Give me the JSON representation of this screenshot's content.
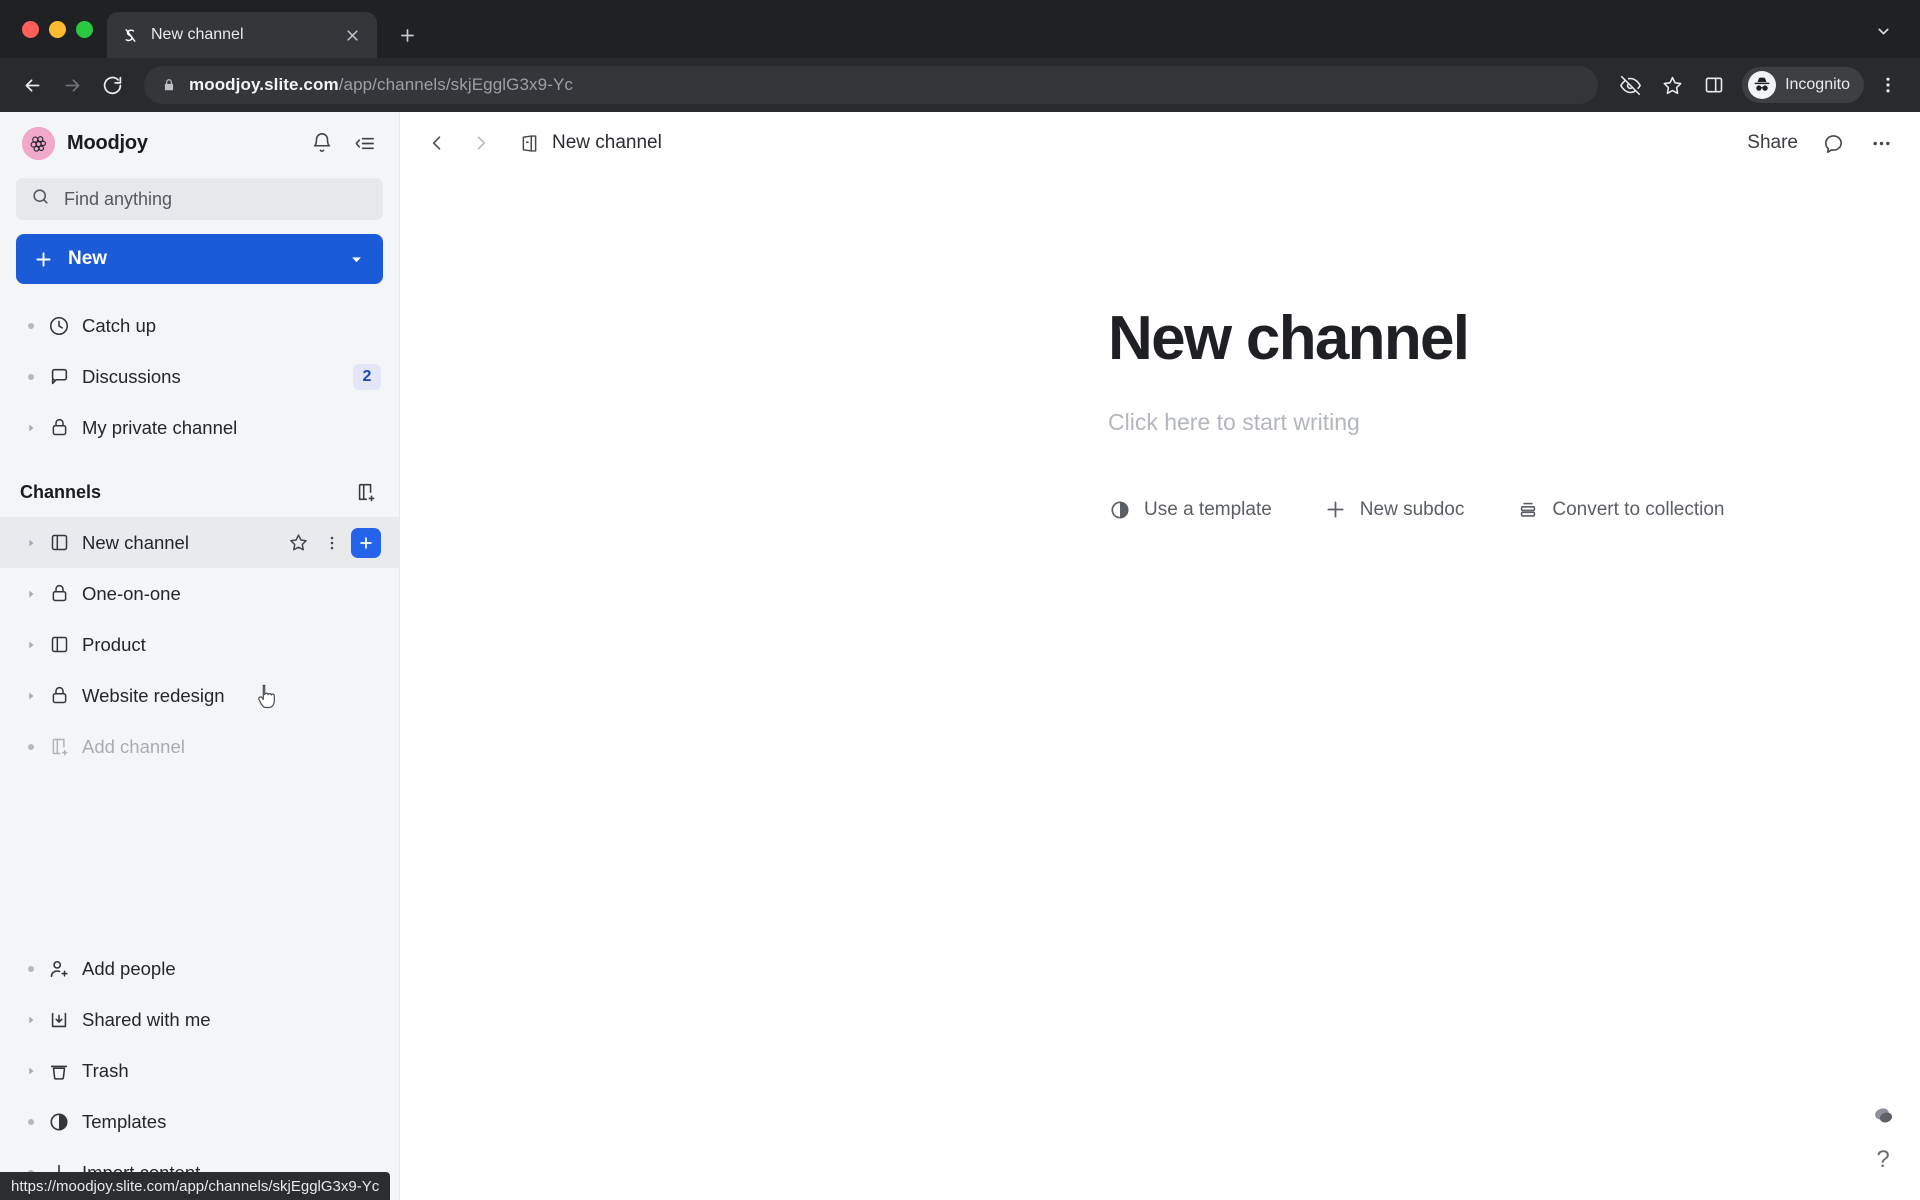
{
  "browser": {
    "tab": {
      "title": "New channel",
      "favicon_icon": "slite-favicon",
      "close_icon": "close-icon"
    },
    "new_tab_icon": "plus-icon",
    "tab_list_icon": "chevron-down-icon",
    "nav": {
      "back_icon": "back-arrow-icon",
      "forward_icon": "forward-arrow-icon",
      "reload_icon": "reload-icon"
    },
    "omnibox": {
      "lock_icon": "lock-icon",
      "url_host": "moodjoy.slite.com",
      "url_path": "/app/channels/skjEgglG3x9-Yc"
    },
    "toolbar_icons": [
      {
        "name": "eye-off-icon"
      },
      {
        "name": "bookmark-star-icon"
      },
      {
        "name": "side-panel-icon"
      },
      {
        "name": "menu-kebab-icon"
      }
    ],
    "incognito": {
      "label": "Incognito",
      "avatar_icon": "incognito-hat-icon"
    },
    "status_url": "https://moodjoy.slite.com/app/channels/skjEgglG3x9-Yc"
  },
  "sidebar": {
    "workspace": {
      "name": "Moodjoy",
      "logo_icon": "moodjoy-berry-logo"
    },
    "header_actions": [
      {
        "name": "notification-bell-icon"
      },
      {
        "name": "collapse-sidebar-icon"
      }
    ],
    "search": {
      "placeholder": "Find anything",
      "icon": "search-icon"
    },
    "new_button": {
      "label": "New",
      "plus_icon": "plus-icon",
      "caret_icon": "caret-down-icon"
    },
    "nav_items": [
      {
        "label": "Catch up",
        "icon": "clock-icon",
        "twisty": "bullet",
        "badge": null
      },
      {
        "label": "Discussions",
        "icon": "chat-bubble-icon",
        "twisty": "bullet",
        "badge": "2"
      },
      {
        "label": "My private channel",
        "icon": "lock-icon",
        "twisty": "arrow",
        "badge": null
      }
    ],
    "channels_section": {
      "title": "Channels",
      "add_icon": "add-channel-icon",
      "items": [
        {
          "label": "New channel",
          "icon": "channel-icon",
          "twisty": "arrow",
          "hovered": true,
          "muted": false
        },
        {
          "label": "One-on-one",
          "icon": "lock-icon",
          "twisty": "arrow",
          "hovered": false,
          "muted": false
        },
        {
          "label": "Product",
          "icon": "channel-icon",
          "twisty": "arrow",
          "hovered": false,
          "muted": false
        },
        {
          "label": "Website redesign",
          "icon": "lock-icon",
          "twisty": "arrow",
          "hovered": false,
          "muted": false
        },
        {
          "label": "Add channel",
          "icon": "add-channel-icon",
          "twisty": "bullet",
          "hovered": false,
          "muted": true
        }
      ],
      "row_actions": [
        {
          "name": "favorite-star-icon"
        },
        {
          "name": "more-options-icon"
        },
        {
          "name": "add-subdoc-icon"
        }
      ]
    },
    "bottom_items": [
      {
        "label": "Add people",
        "icon": "add-person-icon",
        "twisty": "bullet"
      },
      {
        "label": "Shared with me",
        "icon": "inbox-download-icon",
        "twisty": "arrow"
      },
      {
        "label": "Trash",
        "icon": "trash-icon",
        "twisty": "arrow"
      },
      {
        "label": "Templates",
        "icon": "templates-circle-icon",
        "twisty": "bullet"
      },
      {
        "label": "Import content",
        "icon": "download-arrow-icon",
        "twisty": "bullet"
      }
    ]
  },
  "main": {
    "breadcrumb": {
      "label": "New channel",
      "icon": "channel-icon"
    },
    "back_icon": "chevron-left-icon",
    "forward_icon": "chevron-right-icon",
    "share_label": "Share",
    "comment_icon": "comment-bubble-icon",
    "more_icon": "more-horizontal-icon",
    "doc": {
      "title": "New channel",
      "placeholder": "Click here to start writing",
      "actions": [
        {
          "label": "Use a template",
          "icon": "templates-circle-icon"
        },
        {
          "label": "New subdoc",
          "icon": "plus-icon"
        },
        {
          "label": "Convert to collection",
          "icon": "collection-icon"
        }
      ]
    },
    "float_widgets": [
      {
        "name": "assistant-blob-icon"
      },
      {
        "name": "help-question-icon",
        "label": "?"
      }
    ]
  },
  "colors": {
    "accent_blue": "#1b5bd8",
    "badge_bg": "#e2e6f7",
    "badge_text": "#2046b8",
    "sidebar_bg": "#f4f5f7",
    "logo_pink": "#f0a9c8"
  }
}
